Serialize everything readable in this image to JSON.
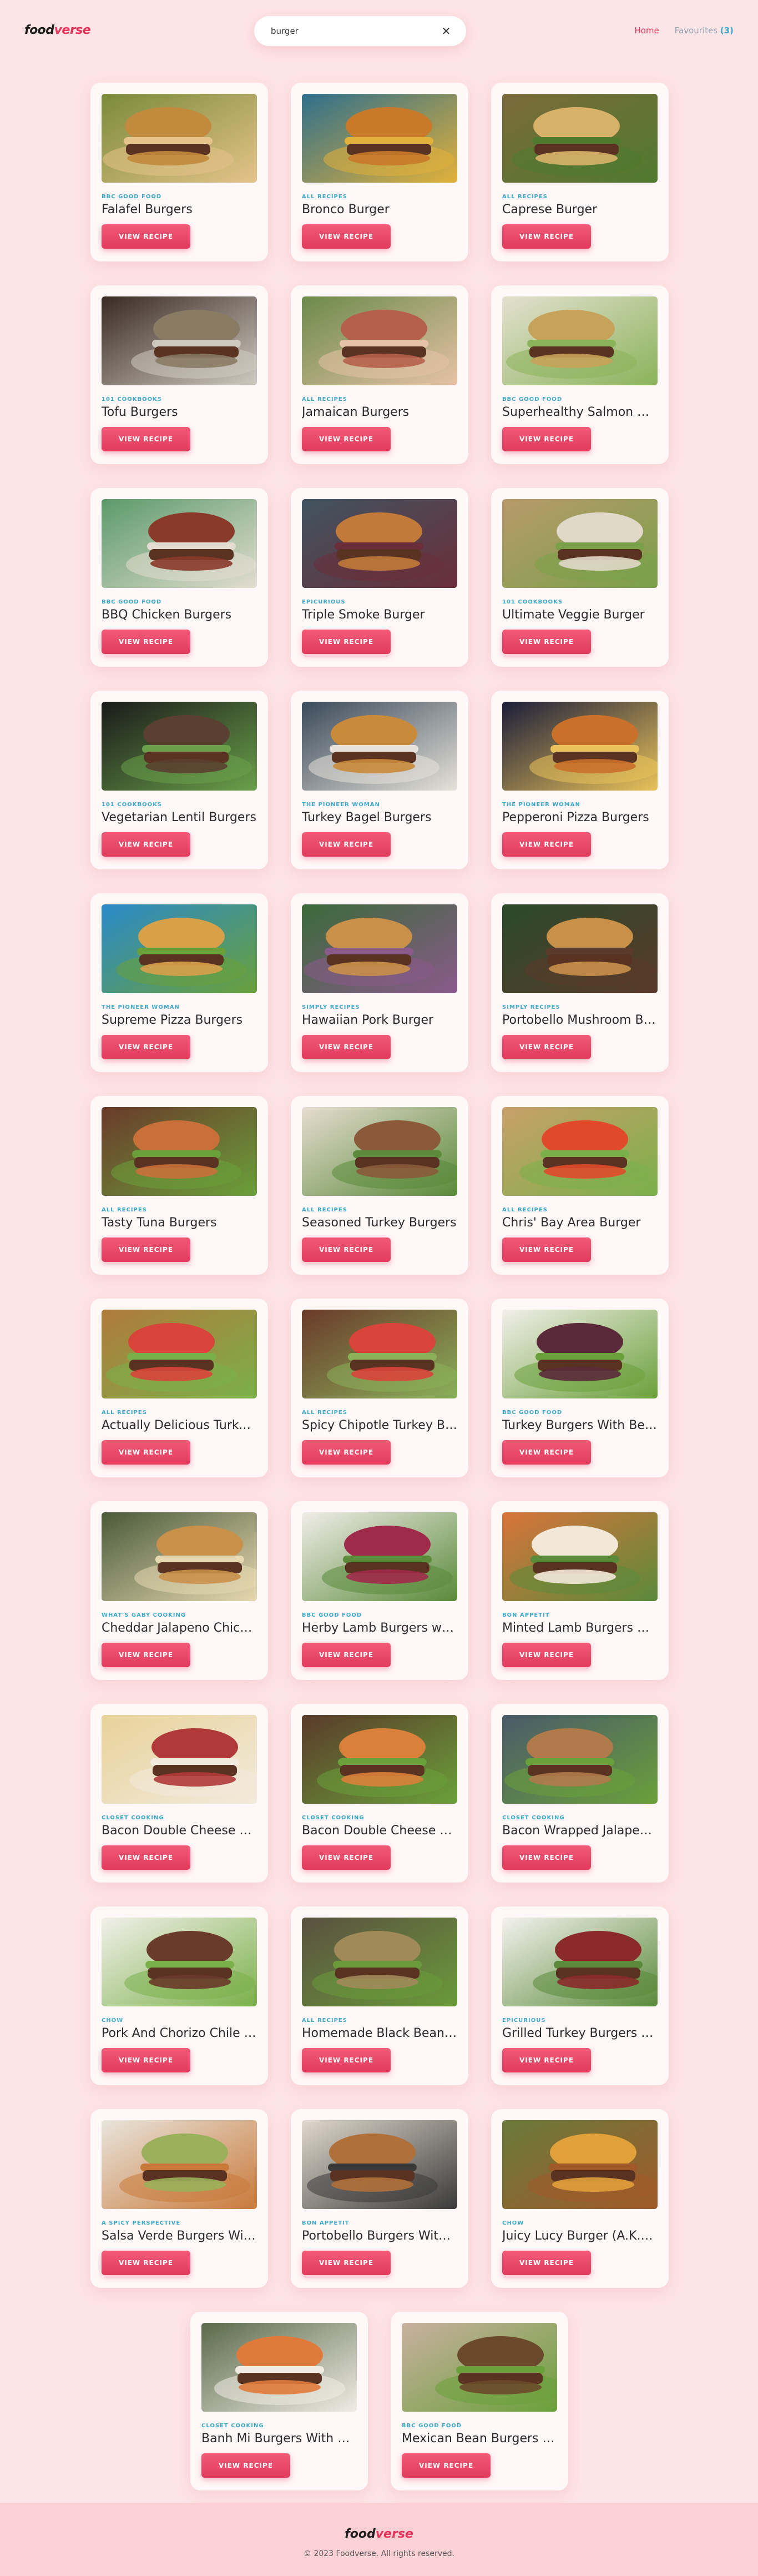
{
  "app": {
    "logo_main": "food",
    "logo_accent": "verse"
  },
  "search": {
    "value": "burger",
    "clear_icon": "close-icon"
  },
  "nav": {
    "home_label": "Home",
    "favourites_label": "Favourites",
    "favourites_count": "(3)"
  },
  "recipes": [
    {
      "publisher": "BBC Good Food",
      "title": "Falafel Burgers",
      "button": "View Recipe",
      "colors": [
        "#7a8a3a",
        "#c28a3c",
        "#e5c38a"
      ]
    },
    {
      "publisher": "All Recipes",
      "title": "Bronco Burger",
      "button": "View Recipe",
      "colors": [
        "#2e6f8c",
        "#c8792a",
        "#e2b13a"
      ]
    },
    {
      "publisher": "All Recipes",
      "title": "Caprese Burger",
      "button": "View Recipe",
      "colors": [
        "#7c6a3c",
        "#d9b26a",
        "#4f7a2e"
      ]
    },
    {
      "publisher": "101 Cookbooks",
      "title": "Tofu Burgers",
      "button": "View Recipe",
      "colors": [
        "#3a2a22",
        "#8a7b64",
        "#cfcac0"
      ]
    },
    {
      "publisher": "All Recipes",
      "title": "Jamaican Burgers",
      "button": "View Recipe",
      "colors": [
        "#6b8a4a",
        "#b5604a",
        "#e6c2a6"
      ]
    },
    {
      "publisher": "BBC Good Food",
      "title": "Superhealthy Salmon Burgers",
      "button": "View Recipe",
      "colors": [
        "#e3e0cf",
        "#c7a25a",
        "#8ab35a"
      ]
    },
    {
      "publisher": "BBC Good Food",
      "title": "BBQ Chicken Burgers",
      "button": "View Recipe",
      "colors": [
        "#5b9a6a",
        "#8a3a2a",
        "#e2ddd0"
      ]
    },
    {
      "publisher": "Epicurious",
      "title": "Triple Smoke Burger",
      "button": "View Recipe",
      "colors": [
        "#405460",
        "#c17a3a",
        "#6a2e3a"
      ]
    },
    {
      "publisher": "101 Cookbooks",
      "title": "Ultimate Veggie Burger",
      "button": "View Recipe",
      "colors": [
        "#b89a6a",
        "#e0d8c8",
        "#7aa04a"
      ]
    },
    {
      "publisher": "101 Cookbooks",
      "title": "Vegetarian Lentil Burgers",
      "button": "View Recipe",
      "colors": [
        "#1a1a1a",
        "#5a4030",
        "#6aa04a"
      ]
    },
    {
      "publisher": "The Pioneer Woman",
      "title": "Turkey Bagel Burgers",
      "button": "View Recipe",
      "colors": [
        "#3a4a5a",
        "#c98a3a",
        "#e6e2da"
      ]
    },
    {
      "publisher": "The Pioneer Woman",
      "title": "Pepperoni Pizza Burgers",
      "button": "View Recipe",
      "colors": [
        "#1c1e3a",
        "#c9702a",
        "#e9c25a"
      ]
    },
    {
      "publisher": "The Pioneer Woman",
      "title": "Supreme Pizza Burgers",
      "button": "View Recipe",
      "colors": [
        "#2a8ac9",
        "#d9a04a",
        "#6aa03a"
      ]
    },
    {
      "publisher": "Simply Recipes",
      "title": "Hawaiian Pork Burger",
      "button": "View Recipe",
      "colors": [
        "#3a6a3a",
        "#c9904a",
        "#8a5a8a"
      ]
    },
    {
      "publisher": "Simply Recipes",
      "title": "Portobello Mushroom Burgers",
      "button": "View Recipe",
      "colors": [
        "#2a4a2a",
        "#c9904a",
        "#5a3a2a"
      ]
    },
    {
      "publisher": "All Recipes",
      "title": "Tasty Tuna Burgers",
      "button": "View Recipe",
      "colors": [
        "#6a3a2a",
        "#c9703a",
        "#6aa03a"
      ]
    },
    {
      "publisher": "All Recipes",
      "title": "Seasoned Turkey Burgers",
      "button": "View Recipe",
      "colors": [
        "#e6dcd0",
        "#8a5a3a",
        "#5a8a3a"
      ]
    },
    {
      "publisher": "All Recipes",
      "title": "Chris' Bay Area Burger",
      "button": "View Recipe",
      "colors": [
        "#c9a06a",
        "#e04a2a",
        "#7ab04a"
      ]
    },
    {
      "publisher": "All Recipes",
      "title": "Actually Delicious Turkey Burgers",
      "button": "View Recipe",
      "colors": [
        "#b07a3a",
        "#d9443a",
        "#7ab04a"
      ]
    },
    {
      "publisher": "All Recipes",
      "title": "Spicy Chipotle Turkey Burgers",
      "button": "View Recipe",
      "colors": [
        "#6a3a2a",
        "#d9443a",
        "#8ab05a"
      ]
    },
    {
      "publisher": "BBC Good Food",
      "title": "Turkey Burgers With Beetroot Relish",
      "button": "View Recipe",
      "colors": [
        "#f2efea",
        "#5a2a3a",
        "#6aa03a"
      ]
    },
    {
      "publisher": "What's Gaby Cooking",
      "title": "Cheddar Jalapeno Chicken Burgers",
      "button": "View Recipe",
      "colors": [
        "#4a5a3a",
        "#c9904a",
        "#e6d8b0"
      ]
    },
    {
      "publisher": "BBC Good Food",
      "title": "Herby Lamb Burgers with Beetroot",
      "button": "View Recipe",
      "colors": [
        "#f0ede8",
        "#a02a4a",
        "#5a8a3a"
      ]
    },
    {
      "publisher": "Bon Appetit",
      "title": "Minted Lamb Burgers with Feta",
      "button": "View Recipe",
      "colors": [
        "#d9743a",
        "#f2e8d8",
        "#5a8a3a"
      ]
    },
    {
      "publisher": "Closet Cooking",
      "title": "Bacon Double Cheese Burger Pizza",
      "button": "View Recipe",
      "colors": [
        "#e8d29a",
        "#b03a3a",
        "#f2eadc"
      ]
    },
    {
      "publisher": "Closet Cooking",
      "title": "Bacon Double Cheese Burger Salad",
      "button": "View Recipe",
      "colors": [
        "#5a3a2a",
        "#d9803a",
        "#6aa03a"
      ]
    },
    {
      "publisher": "Closet Cooking",
      "title": "Bacon Wrapped Jalapeno Popper Burgers",
      "button": "View Recipe",
      "colors": [
        "#4a5a6a",
        "#b07a4a",
        "#6aa03a"
      ]
    },
    {
      "publisher": "Chow",
      "title": "Pork And Chorizo Chile Burgers",
      "button": "View Recipe",
      "colors": [
        "#f2f0ea",
        "#6a3a2a",
        "#7ab04a"
      ]
    },
    {
      "publisher": "All Recipes",
      "title": "Homemade Black Bean Veggie Burgers",
      "button": "View Recipe",
      "colors": [
        "#5a5040",
        "#a08a5a",
        "#6a9a3a"
      ]
    },
    {
      "publisher": "Epicurious",
      "title": "Grilled Turkey Burgers with Cheddar",
      "button": "View Recipe",
      "colors": [
        "#f4f2ee",
        "#8a2a2a",
        "#5a8a3a"
      ]
    },
    {
      "publisher": "A Spicy Perspective",
      "title": "Salsa Verde Burgers With Guacamole",
      "button": "View Recipe",
      "colors": [
        "#e8e4dc",
        "#9ab05a",
        "#c97a3a"
      ]
    },
    {
      "publisher": "Bon Appetit",
      "title": "Portobello Burgers With Goat Cheese",
      "button": "View Recipe",
      "colors": [
        "#e0d8cc",
        "#b0703a",
        "#3a3a3a"
      ]
    },
    {
      "publisher": "Chow",
      "title": "Juicy Lucy Burger (A.K.A. Jucy Lucy)",
      "button": "View Recipe",
      "colors": [
        "#6a7a3a",
        "#e0a03a",
        "#a05a2a"
      ]
    },
    {
      "publisher": "Closet Cooking",
      "title": "Banh Mi Burgers With Spicy Sriracha Mayo",
      "button": "View Recipe",
      "colors": [
        "#5a6a4a",
        "#e07a3a",
        "#f0ece4"
      ]
    },
    {
      "publisher": "BBC Good Food",
      "title": "Mexican Bean Burgers with Lime Yogurt & Salsa",
      "button": "View Recipe",
      "colors": [
        "#c9b0a0",
        "#6a4a2a",
        "#6aa03a"
      ]
    }
  ],
  "footer": {
    "logo_main": "food",
    "logo_accent": "verse",
    "copyright": "© 2023 Foodverse. All rights reserved."
  }
}
